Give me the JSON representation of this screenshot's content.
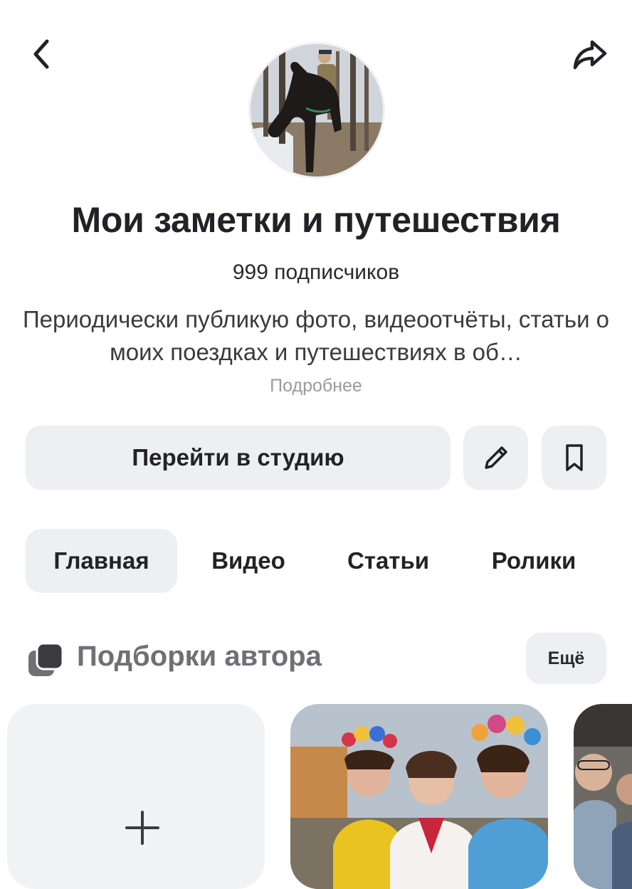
{
  "header": {
    "back_icon": "chevron-left-icon",
    "share_icon": "share-arrow-icon"
  },
  "profile": {
    "avatar_alt": "rider-on-horse",
    "title": "Мои заметки и путешествия",
    "subscribers": "999 подписчиков",
    "description": "Периодически публикую фото, видеоотчёты, статьи о моих поездках и путешествиях в об…",
    "more_link": "Подробнее"
  },
  "actions": {
    "studio_label": "Перейти в студию",
    "edit_icon": "pencil-icon",
    "bookmark_icon": "bookmark-icon"
  },
  "tabs": [
    {
      "label": "Главная",
      "active": true
    },
    {
      "label": "Видео",
      "active": false
    },
    {
      "label": "Статьи",
      "active": false
    },
    {
      "label": "Ролики",
      "active": false
    }
  ],
  "collections": {
    "icon": "collections-stack-icon",
    "title": "Подборки автора",
    "more_label": "Ещё",
    "cards": [
      {
        "kind": "add",
        "icon": "plus-icon"
      },
      {
        "kind": "photo",
        "image": "women-in-flower-wreaths"
      },
      {
        "kind": "photo",
        "image": "people-photo-partial"
      }
    ]
  },
  "colors": {
    "background": "#ffffff",
    "button_bg": "#eeeff2",
    "text_primary": "#222226",
    "text_muted": "#9a9aa0",
    "section_title": "#6f6f74"
  }
}
